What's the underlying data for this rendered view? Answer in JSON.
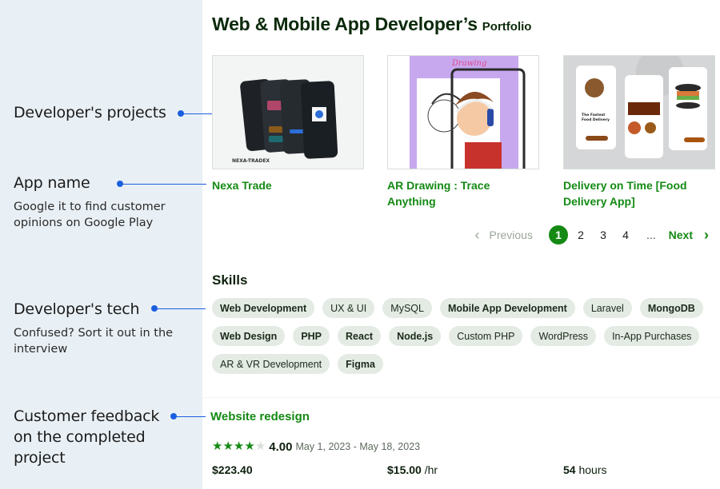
{
  "annotations": [
    {
      "title": "Developer's projects",
      "description": ""
    },
    {
      "title": "App name",
      "description": "Google it to find customer opinions on Google Play"
    },
    {
      "title": "Developer's tech",
      "description": "Confused? Sort it out in the interview"
    },
    {
      "title": "Customer feedback on the completed project",
      "description": ""
    }
  ],
  "header": {
    "title": "Web & Mobile App Developer’s",
    "subtitle": "Portfolio"
  },
  "projects": [
    {
      "name": "Nexa Trade",
      "thumb_label": "NEXA-TRADEX"
    },
    {
      "name": "AR Drawing : Trace Anything",
      "thumb_label": "Drawing"
    },
    {
      "name": "Delivery on Time [Food Delivery App]",
      "thumb_label": "The Fastest Food Delivery"
    }
  ],
  "pagination": {
    "previous_label": "Previous",
    "pages": [
      "1",
      "2",
      "3",
      "4"
    ],
    "current_page": "1",
    "ellipsis": "...",
    "next_label": "Next"
  },
  "skills": {
    "title": "Skills",
    "items": [
      {
        "label": "Web Development",
        "emphasis": true
      },
      {
        "label": "UX & UI",
        "emphasis": false
      },
      {
        "label": "MySQL",
        "emphasis": false
      },
      {
        "label": "Mobile App Development",
        "emphasis": true
      },
      {
        "label": "Laravel",
        "emphasis": false
      },
      {
        "label": "MongoDB",
        "emphasis": true
      },
      {
        "label": "Web Design",
        "emphasis": true
      },
      {
        "label": "PHP",
        "emphasis": true
      },
      {
        "label": "React",
        "emphasis": true
      },
      {
        "label": "Node.js",
        "emphasis": true
      },
      {
        "label": "Custom PHP",
        "emphasis": false
      },
      {
        "label": "WordPress",
        "emphasis": false
      },
      {
        "label": "In-App Purchases",
        "emphasis": false
      },
      {
        "label": "AR & VR Development",
        "emphasis": false
      },
      {
        "label": "Figma",
        "emphasis": true
      }
    ]
  },
  "feedback": {
    "project_title": "Website redesign",
    "rating": 4,
    "rating_max": 5,
    "rating_label": "4.00",
    "dates": "May 1, 2023 - May 18, 2023",
    "total": "$223.40",
    "rate_value": "$15.00",
    "rate_unit": "/hr",
    "hours_value": "54",
    "hours_unit": "hours"
  },
  "colors": {
    "accent_green": "#148a14",
    "connector_blue": "#1a5fe0",
    "annotation_panel": "#e9f0f5",
    "chip_bg": "#e4ebe4"
  }
}
